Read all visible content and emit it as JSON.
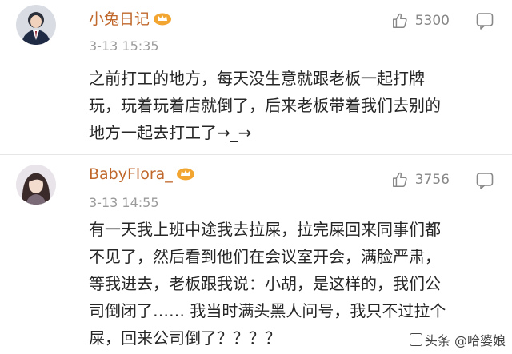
{
  "comments": [
    {
      "username": "小兔日记",
      "time": "3-13 15:35",
      "likes": "5300",
      "lines": [
        "之前打工的地方，每天没生意就跟老板一起打牌",
        "玩，玩着玩着店就倒了，后来老板带着我们去别的",
        "地方一起去打工了→_→"
      ],
      "avatar_icon": "suit-avatar-icon",
      "badge_icon": "vip-crown-icon"
    },
    {
      "username": "BabyFlora_",
      "time": "3-13 14:55",
      "likes": "3756",
      "lines": [
        "有一天我上班中途我去拉屎，拉完屎回来同事们都",
        "不见了，然后看到他们在会议室开会，满脸严肃，",
        "等我进去，老板跟我说：小胡，是这样的，我们公",
        "司倒闭了…… 我当时满头黑人问号，我只不过拉个",
        "屎，回来公司倒了？？？？"
      ],
      "avatar_icon": "girl-avatar-icon",
      "badge_icon": "vip-crown-icon"
    }
  ],
  "watermark": "头条 @哈婆娘",
  "colors": {
    "username": "#c0682c",
    "meta": "#9a9a9a",
    "text": "#262626"
  }
}
